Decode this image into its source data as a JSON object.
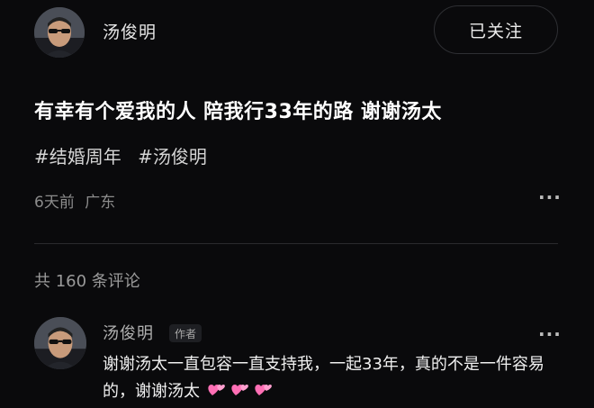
{
  "post": {
    "author": "汤俊明",
    "follow_label": "已关注",
    "title": "有幸有个爱我的人 陪我行33年的路 谢谢汤太",
    "hashtags": [
      "#结婚周年",
      "#汤俊明"
    ],
    "time": "6天前",
    "location": "广东",
    "more_label": "···"
  },
  "comments": {
    "count_label": "共 160 条评论",
    "items": [
      {
        "author": "汤俊明",
        "badge": "作者",
        "text": "谢谢汤太一直包容一直支持我，一起33年，真的不是一件容易的，谢谢汤太",
        "emojis": [
          "two-hearts-icon",
          "two-hearts-icon",
          "two-hearts-icon"
        ],
        "more_label": "···"
      }
    ]
  },
  "colors": {
    "background": "#0a0a0c",
    "heart": "#ff6fb5"
  }
}
